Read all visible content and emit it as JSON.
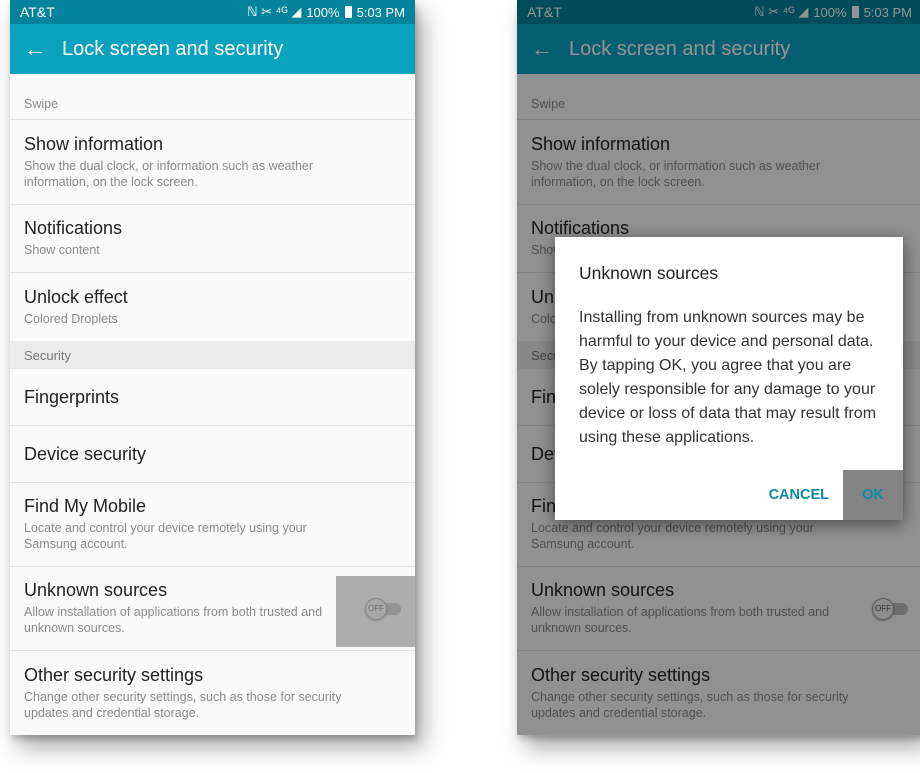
{
  "status": {
    "carrier": "AT&T",
    "icons": "ℕ ✂ ⁴ᴳ ◢",
    "battery": "100%",
    "time": "5:03 PM"
  },
  "appbar": {
    "back_icon": "arrow-left-icon",
    "title": "Lock screen and security"
  },
  "top_partial": {
    "sub": "Swipe"
  },
  "items": {
    "show_info": {
      "title": "Show information",
      "sub": "Show the dual clock, or information such as weather information, on the lock screen."
    },
    "notifications": {
      "title": "Notifications",
      "sub": "Show content"
    },
    "unlock_effect": {
      "title": "Unlock effect",
      "sub": "Colored Droplets"
    },
    "section_security": "Security",
    "fingerprints": {
      "title": "Fingerprints"
    },
    "device_security": {
      "title": "Device security"
    },
    "find_my_mobile": {
      "title": "Find My Mobile",
      "sub": "Locate and control your device remotely using your Samsung account."
    },
    "unknown_sources": {
      "title": "Unknown sources",
      "sub": "Allow installation of applications from both trusted and unknown sources.",
      "toggle": "OFF"
    },
    "other_security": {
      "title": "Other security settings",
      "sub": "Change other security settings, such as those for security updates and credential storage."
    }
  },
  "dialog": {
    "title": "Unknown sources",
    "body": "Installing from unknown sources may be harmful to your device and personal data. By tapping OK, you agree that you are solely responsible for any damage to your device or loss of data that may result from using these applications.",
    "cancel": "CANCEL",
    "ok": "OK"
  },
  "colors": {
    "statusbar": "#03849b",
    "appbar": "#0aa2bf",
    "accent": "#0a8aa6"
  }
}
